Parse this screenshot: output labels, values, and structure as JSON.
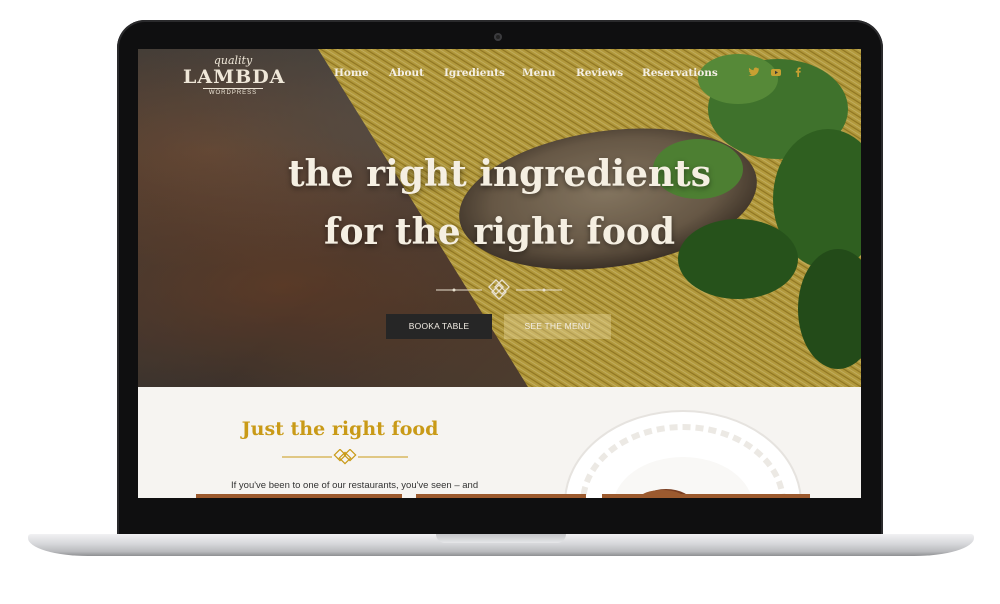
{
  "site": {
    "logo": {
      "small": "quality",
      "main": "LAMBDA",
      "sub": "WORDPRESS"
    },
    "nav": [
      {
        "label": "Home"
      },
      {
        "label": "About"
      },
      {
        "label": "Igredients"
      },
      {
        "label": "Menu"
      },
      {
        "label": "Reviews"
      },
      {
        "label": "Reservations"
      }
    ],
    "social": [
      {
        "icon": "twitter-icon"
      },
      {
        "icon": "youtube-icon"
      },
      {
        "icon": "facebook-icon"
      }
    ],
    "hero": {
      "line1": "the right ingredients",
      "line2": "for the right food",
      "btn_book": "BOOKA TABLE",
      "btn_menu": "SEE THE MENU"
    },
    "section": {
      "title": "Just the right food",
      "text": "If you've been to one of our restaurants, you've seen – and"
    }
  },
  "colors": {
    "accent": "#c99a17",
    "dark_button": "#262626",
    "social": "#c8a032"
  }
}
